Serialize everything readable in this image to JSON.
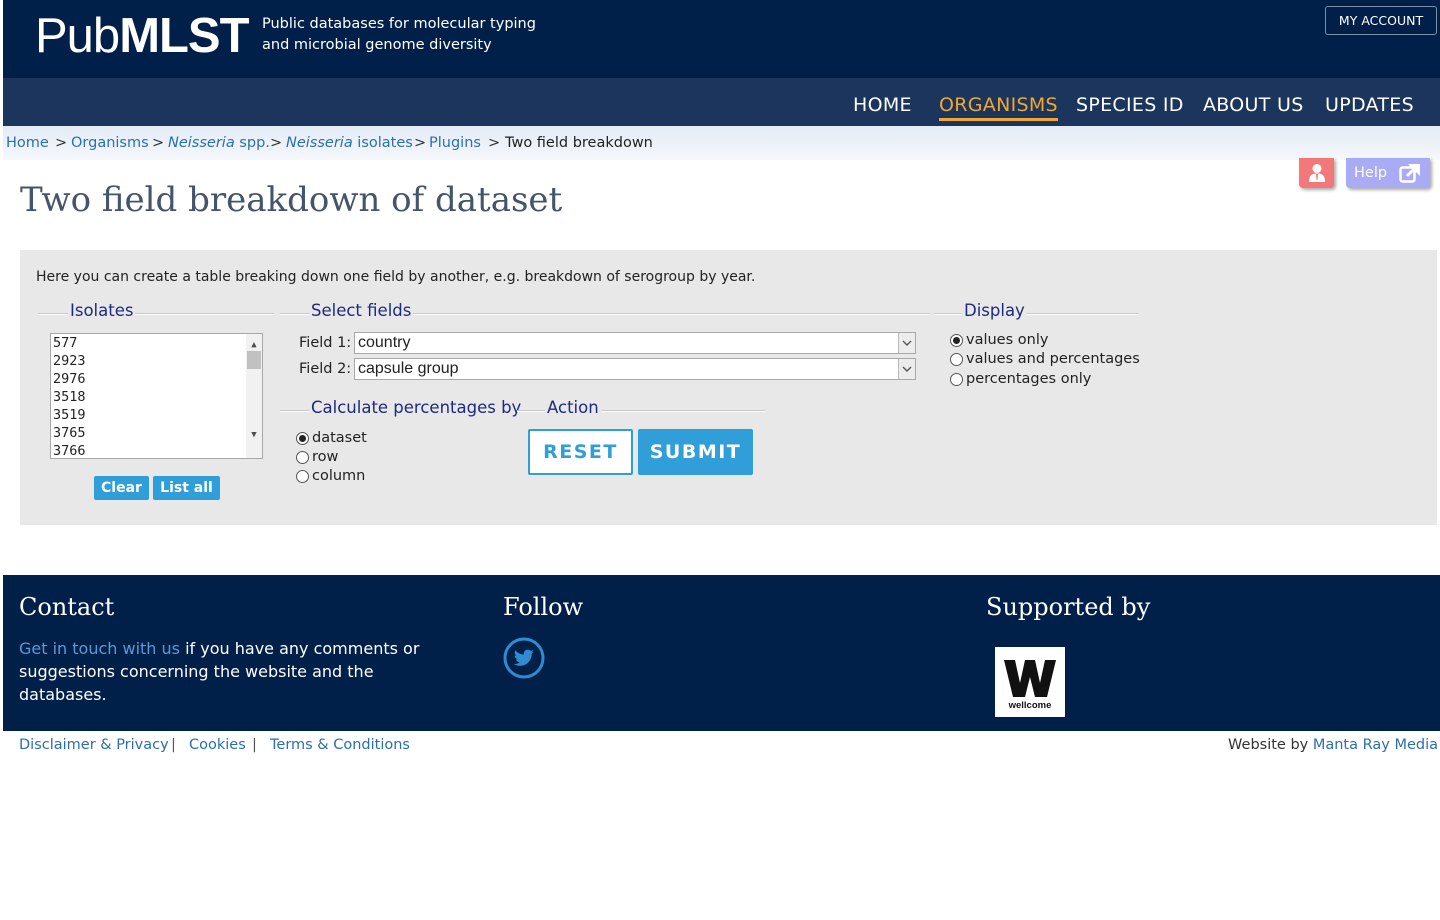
{
  "header": {
    "logo_light": "Pub",
    "logo_bold": "MLST",
    "tagline_line1": "Public databases for molecular typing",
    "tagline_line2": "and microbial genome diversity",
    "my_account": "MY ACCOUNT"
  },
  "nav": {
    "home": "HOME",
    "organisms": "ORGANISMS",
    "species_id": "SPECIES ID",
    "about_us": "ABOUT US",
    "updates": "UPDATES",
    "active_color": "#f0a830"
  },
  "breadcrumb": {
    "home": "Home",
    "organisms": "Organisms",
    "neisseria_italic": "Neisseria",
    "spp": " spp.",
    "isolates_italic": "Neisseria",
    "isolates": " isolates",
    "plugins": "Plugins",
    "current": "Two field breakdown",
    "separator": ">"
  },
  "quick_links": {
    "user_icon": "user-icon",
    "help": "Help",
    "help_icon": "external-link-icon"
  },
  "page": {
    "title": "Two field breakdown of dataset",
    "intro": "Here you can create a table breaking down one field by another, e.g. breakdown of serogroup by year."
  },
  "isolates": {
    "legend": "Isolates",
    "ids": [
      "577",
      "2923",
      "2976",
      "3518",
      "3519",
      "3765",
      "3766"
    ],
    "clear": "Clear",
    "list_all": "List all"
  },
  "select_fields": {
    "legend": "Select fields",
    "field1_label": "Field 1:",
    "field1_value": "country",
    "field2_label": "Field 2:",
    "field2_value": "capsule group"
  },
  "display": {
    "legend": "Display",
    "options": [
      "values only",
      "values and percentages",
      "percentages only"
    ],
    "selected": "values only"
  },
  "percentages": {
    "legend": "Calculate percentages by",
    "options": [
      "dataset",
      "row",
      "column"
    ],
    "selected": "dataset"
  },
  "action": {
    "legend": "Action",
    "reset": "RESET",
    "submit": "SUBMIT",
    "button_color": "#309ed8"
  },
  "footer": {
    "contact_heading": "Contact",
    "contact_link": "Get in touch with us",
    "contact_text": " if you have any comments or suggestions concerning the website and the databases.",
    "follow_heading": "Follow",
    "twitter_icon": "twitter-icon",
    "supported_heading": "Supported by",
    "wellcome_logo_text": "wellcome",
    "background": "#00204a"
  },
  "bottom": {
    "disclaimer": "Disclaimer & Privacy",
    "cookies": "Cookies",
    "terms": "Terms & Conditions",
    "divider": "|",
    "website_by": "Website by ",
    "manta": "Manta Ray Media"
  }
}
